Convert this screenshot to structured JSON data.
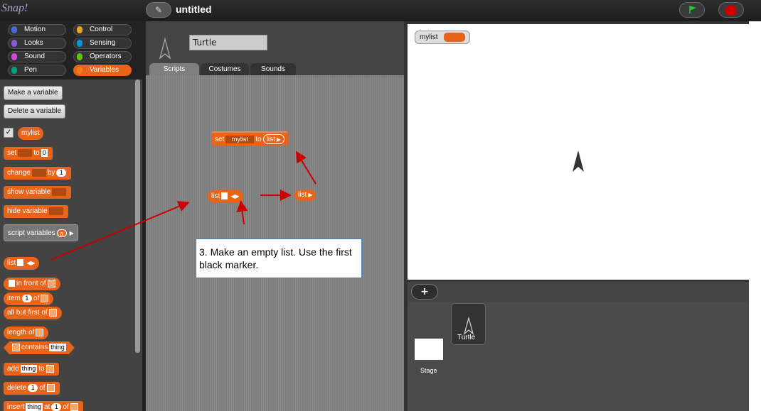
{
  "app": {
    "logo": "Snap!",
    "project_name": "untitled"
  },
  "categories": [
    {
      "label": "Motion",
      "color": "#4a6cd4"
    },
    {
      "label": "Control",
      "color": "#e6a822"
    },
    {
      "label": "Looks",
      "color": "#8a55d7"
    },
    {
      "label": "Sensing",
      "color": "#0494dc"
    },
    {
      "label": "Sound",
      "color": "#cf4ad9"
    },
    {
      "label": "Operators",
      "color": "#62c213"
    },
    {
      "label": "Pen",
      "color": "#00a178"
    },
    {
      "label": "Variables",
      "color": "#ee7d16"
    }
  ],
  "palette": {
    "make_var": "Make a variable",
    "delete_var": "Delete a variable",
    "var_name": "mylist",
    "set_label": "set",
    "to_label": "to",
    "zero": "0",
    "change_label": "change",
    "by_label": "by",
    "one": "1",
    "show_var": "show variable",
    "hide_var": "hide variable",
    "script_vars": "script variables",
    "a": "a",
    "list": "list",
    "in_front_of": "in front of",
    "item": "item",
    "of": "of",
    "all_but_first": "all but first of",
    "length_of": "length of",
    "contains": "contains",
    "thing": "thing",
    "add": "add",
    "delete": "delete",
    "insert": "insert",
    "at": "at"
  },
  "sprite": {
    "name": "Turtle"
  },
  "tabs": [
    "Scripts",
    "Costumes",
    "Sounds"
  ],
  "script": {
    "set_label": "set",
    "var": "mylist",
    "to_label": "to",
    "list": "list",
    "list2": "list",
    "list3": "list"
  },
  "callout": "3.  Make an empty list. Use the first black marker.",
  "stage": {
    "watcher_label": "mylist"
  },
  "corral": {
    "stage_label": "Stage",
    "sprite_label": "Turtle",
    "add_label": "+"
  }
}
